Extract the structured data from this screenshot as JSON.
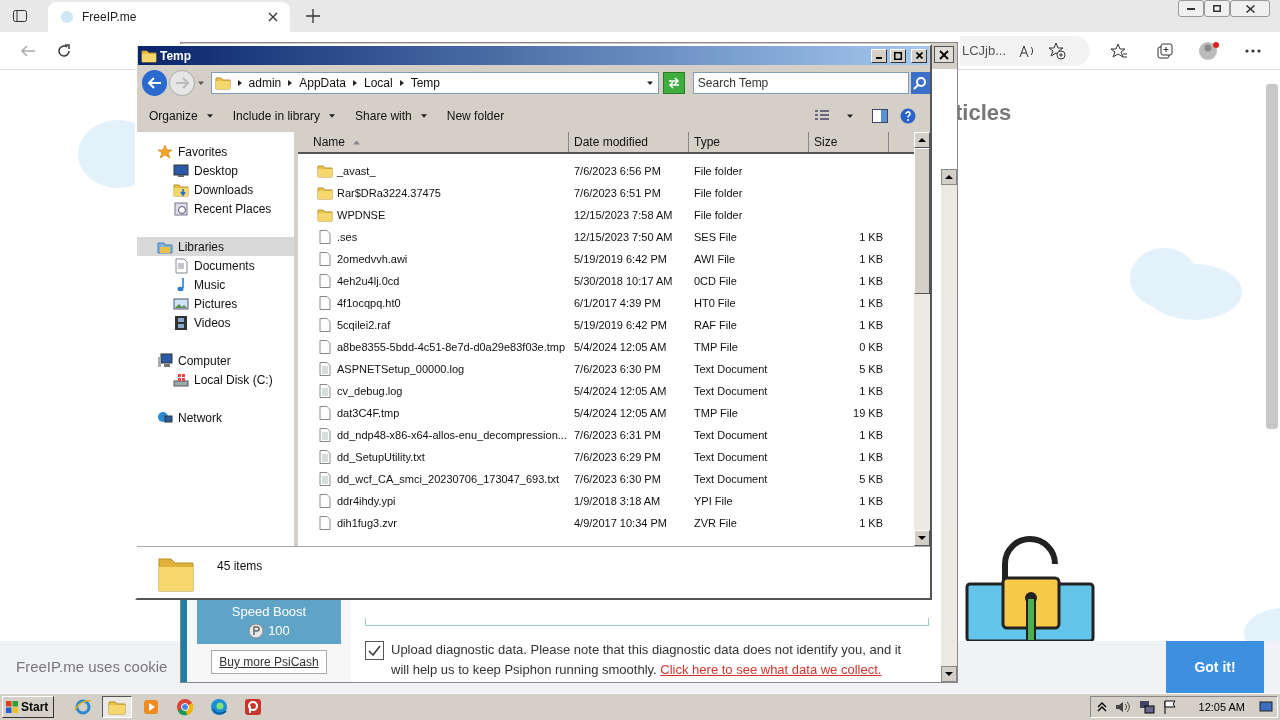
{
  "browser": {
    "tab_title": "FreeIP.me",
    "address_fragment": "LCJjb...",
    "heading_fragment": "ticles",
    "cookie_text": "FreeIP.me uses cookie",
    "cookie_button": "Got it!"
  },
  "psiphon": {
    "speed_boost": "Speed Boost",
    "coin_amount": "100",
    "buy_button": "Buy more PsiCash",
    "diagnostic": {
      "checked": true,
      "text": "Upload diagnostic data. Please note that this diagnostic data does not identify you, and it will help us to keep Psiphon running smoothly.",
      "link": "Click here to see what data we collect."
    }
  },
  "explorer": {
    "title": "Temp",
    "breadcrumb": [
      "admin",
      "AppData",
      "Local",
      "Temp"
    ],
    "search_placeholder": "Search Temp",
    "toolbar": [
      {
        "label": "Organize",
        "dropdown": true
      },
      {
        "label": "Include in library",
        "dropdown": true
      },
      {
        "label": "Share with",
        "dropdown": true
      },
      {
        "label": "New folder",
        "dropdown": false
      }
    ],
    "nav": [
      {
        "label": "Favorites",
        "kind": "star",
        "selected": false,
        "children": [
          {
            "label": "Desktop",
            "kind": "desktop",
            "selected": false
          },
          {
            "label": "Downloads",
            "kind": "downloads",
            "selected": false
          },
          {
            "label": "Recent Places",
            "kind": "recent",
            "selected": false
          }
        ]
      },
      {
        "label": "Libraries",
        "kind": "library",
        "selected": true,
        "children": [
          {
            "label": "Documents",
            "kind": "documents",
            "selected": false
          },
          {
            "label": "Music",
            "kind": "music",
            "selected": false
          },
          {
            "label": "Pictures",
            "kind": "pictures",
            "selected": false
          },
          {
            "label": "Videos",
            "kind": "videos",
            "selected": false
          }
        ]
      },
      {
        "label": "Computer",
        "kind": "computer",
        "selected": false,
        "children": [
          {
            "label": "Local Disk (C:)",
            "kind": "disk",
            "selected": false
          }
        ]
      },
      {
        "label": "Network",
        "kind": "network",
        "selected": false
      }
    ],
    "columns": [
      {
        "label": "Name",
        "sorted": true
      },
      {
        "label": "Date modified",
        "sorted": false
      },
      {
        "label": "Type",
        "sorted": false
      },
      {
        "label": "Size",
        "sorted": false
      }
    ],
    "rows": [
      {
        "kind": "folder",
        "name": "_avast_",
        "date": "7/6/2023 6:56 PM",
        "type": "File folder",
        "selected": false
      },
      {
        "kind": "folder",
        "name": "Rar$DRa3224.37475",
        "date": "7/6/2023 6:51 PM",
        "type": "File folder",
        "selected": false
      },
      {
        "kind": "folder",
        "name": "WPDNSE",
        "date": "12/15/2023 7:58 AM",
        "type": "File folder",
        "selected": false
      },
      {
        "kind": "file",
        "name": ".ses",
        "date": "12/15/2023 7:50 AM",
        "type": "SES File",
        "size": "1 KB",
        "selected": false
      },
      {
        "kind": "file",
        "name": "2omedvvh.awi",
        "date": "5/19/2019 6:42 PM",
        "type": "AWI File",
        "size": "1 KB",
        "selected": false
      },
      {
        "kind": "file",
        "name": "4eh2u4lj.0cd",
        "date": "5/30/2018 10:17 AM",
        "type": "0CD File",
        "size": "1 KB",
        "selected": false
      },
      {
        "kind": "file",
        "name": "4f1ocqpq.ht0",
        "date": "6/1/2017 4:39 PM",
        "type": "HT0 File",
        "size": "1 KB",
        "selected": false
      },
      {
        "kind": "file",
        "name": "5cqilei2.raf",
        "date": "5/19/2019 6:42 PM",
        "type": "RAF File",
        "size": "1 KB",
        "selected": false
      },
      {
        "kind": "file",
        "name": "a8be8355-5bdd-4c51-8e7d-d0a29e83f03e.tmp",
        "date": "5/4/2024 12:05 AM",
        "type": "TMP File",
        "size": "0 KB",
        "selected": false
      },
      {
        "kind": "text",
        "name": "ASPNETSetup_00000.log",
        "date": "7/6/2023 6:30 PM",
        "type": "Text Document",
        "size": "5 KB",
        "selected": false
      },
      {
        "kind": "text",
        "name": "cv_debug.log",
        "date": "5/4/2024 12:05 AM",
        "type": "Text Document",
        "size": "1 KB",
        "selected": false
      },
      {
        "kind": "file",
        "name": "dat3C4F.tmp",
        "date": "5/4/2024 12:05 AM",
        "type": "TMP File",
        "size": "19 KB",
        "selected": false
      },
      {
        "kind": "text",
        "name": "dd_ndp48-x86-x64-allos-enu_decompression...",
        "date": "7/6/2023 6:31 PM",
        "type": "Text Document",
        "size": "1 KB",
        "selected": false
      },
      {
        "kind": "text",
        "name": "dd_SetupUtility.txt",
        "date": "7/6/2023 6:29 PM",
        "type": "Text Document",
        "size": "1 KB",
        "selected": false
      },
      {
        "kind": "text",
        "name": "dd_wcf_CA_smci_20230706_173047_693.txt",
        "date": "7/6/2023 6:30 PM",
        "type": "Text Document",
        "size": "5 KB",
        "selected": false
      },
      {
        "kind": "file",
        "name": "ddr4ihdy.ypi",
        "date": "1/9/2018 3:18 AM",
        "type": "YPI File",
        "size": "1 KB",
        "selected": false
      },
      {
        "kind": "file",
        "name": "dih1fug3.zvr",
        "date": "4/9/2017 10:34 PM",
        "type": "ZVR File",
        "size": "1 KB",
        "selected": false
      }
    ],
    "status": "45 items"
  },
  "taskbar": {
    "start": "Start",
    "clock": "12:05 AM",
    "apps": [
      {
        "kind": "ie",
        "active": false
      },
      {
        "kind": "explorer",
        "active": true
      },
      {
        "kind": "media",
        "active": false
      },
      {
        "kind": "chrome",
        "active": false
      },
      {
        "kind": "edge",
        "active": false
      },
      {
        "kind": "psiphon",
        "active": false
      }
    ]
  }
}
